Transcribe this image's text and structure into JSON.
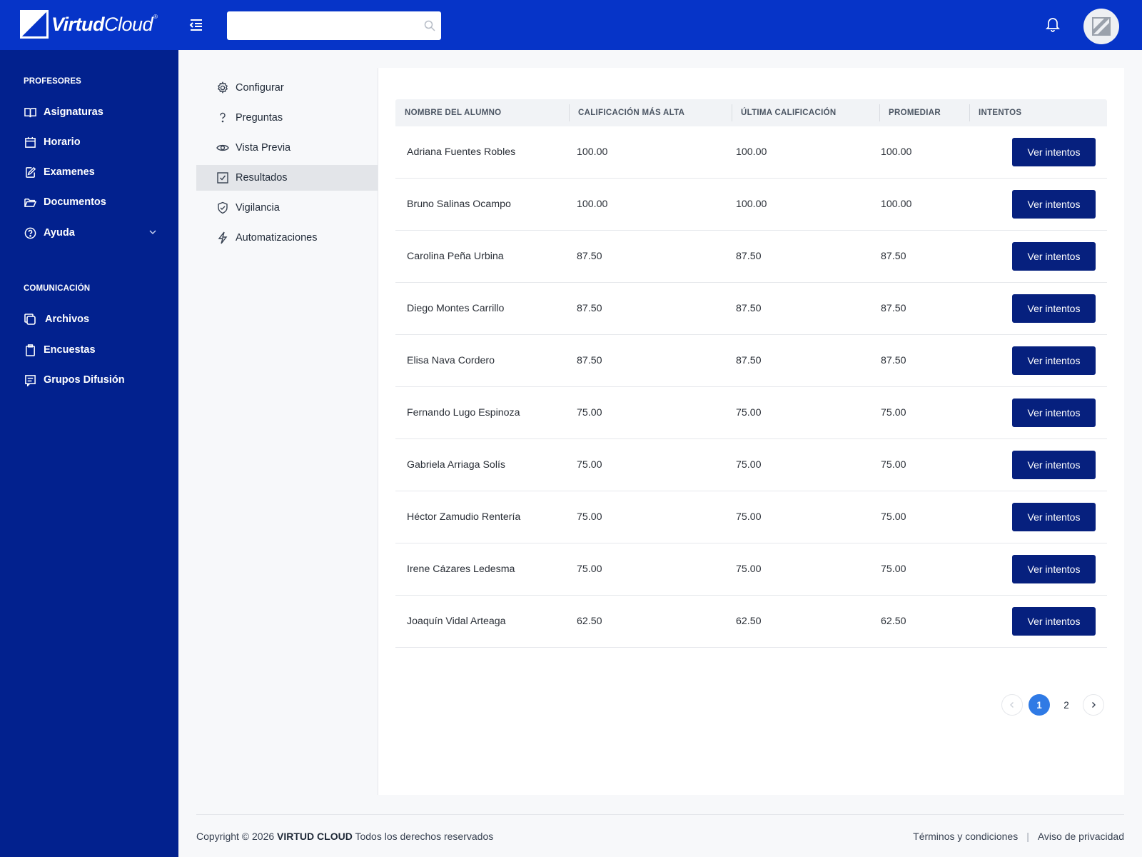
{
  "brand": {
    "name_bold": "Virtud",
    "name_light": "Cloud",
    "trademark": "®"
  },
  "header": {
    "search": {
      "value": "",
      "placeholder": ""
    },
    "icons": {
      "menu": "menu-collapse-icon",
      "search": "search-icon",
      "notifications": "bell-icon",
      "avatar": "avatar-icon"
    }
  },
  "colors": {
    "header_bg": "#0634c8",
    "sidebar_bg": "#02218e",
    "button_bg": "#06207e",
    "pager_active": "#2f7ae5"
  },
  "sidebar": {
    "sections": [
      {
        "title": "PROFESORES",
        "items": [
          {
            "label": "Asignaturas",
            "icon": "book-open-icon"
          },
          {
            "label": "Horario",
            "icon": "calendar-icon"
          },
          {
            "label": "Examenes",
            "icon": "edit-document-icon"
          },
          {
            "label": "Documentos",
            "icon": "folder-open-icon"
          },
          {
            "label": "Ayuda",
            "icon": "help-circle-icon",
            "has_submenu": true
          }
        ]
      },
      {
        "title": "COMUNICACIÓN",
        "items": [
          {
            "label": "Archivos",
            "icon": "copy-files-icon"
          },
          {
            "label": "Encuestas",
            "icon": "clipboard-icon"
          },
          {
            "label": "Grupos Difusión",
            "icon": "message-list-icon"
          }
        ]
      }
    ]
  },
  "subnav": {
    "items": [
      {
        "label": "Configurar",
        "icon": "gear-icon"
      },
      {
        "label": "Preguntas",
        "icon": "question-mark-icon"
      },
      {
        "label": "Vista Previa",
        "icon": "eye-icon"
      },
      {
        "label": "Resultados",
        "icon": "checkbox-icon",
        "active": true
      },
      {
        "label": "Vigilancia",
        "icon": "shield-check-icon"
      },
      {
        "label": "Automatizaciones",
        "icon": "lightning-icon"
      }
    ]
  },
  "table": {
    "headers": [
      "NOMBRE DEL ALUMNO",
      "CALIFICACIÓN MÁS ALTA",
      "ÚLTIMA CALIFICACIÓN",
      "PROMEDIAR",
      "INTENTOS"
    ],
    "button_label": "Ver intentos",
    "rows": [
      {
        "name": "Adriana Fuentes Robles",
        "highest": "100.00",
        "last": "100.00",
        "average": "100.00"
      },
      {
        "name": "Bruno Salinas Ocampo",
        "highest": "100.00",
        "last": "100.00",
        "average": "100.00"
      },
      {
        "name": "Carolina Peña Urbina",
        "highest": "87.50",
        "last": "87.50",
        "average": "87.50"
      },
      {
        "name": "Diego Montes Carrillo",
        "highest": "87.50",
        "last": "87.50",
        "average": "87.50"
      },
      {
        "name": "Elisa Nava Cordero",
        "highest": "87.50",
        "last": "87.50",
        "average": "87.50"
      },
      {
        "name": "Fernando Lugo Espinoza",
        "highest": "75.00",
        "last": "75.00",
        "average": "75.00"
      },
      {
        "name": "Gabriela Arriaga Solís",
        "highest": "75.00",
        "last": "75.00",
        "average": "75.00"
      },
      {
        "name": "Héctor Zamudio Rentería",
        "highest": "75.00",
        "last": "75.00",
        "average": "75.00"
      },
      {
        "name": "Irene Cázares Ledesma",
        "highest": "75.00",
        "last": "75.00",
        "average": "75.00"
      },
      {
        "name": "Joaquín Vidal Arteaga",
        "highest": "62.50",
        "last": "62.50",
        "average": "62.50"
      }
    ]
  },
  "pagination": {
    "pages": [
      "1",
      "2"
    ],
    "current": "1",
    "prev_icon": "chevron-left-icon",
    "next_icon": "chevron-right-icon"
  },
  "footer": {
    "copyright_prefix": "Copyright © 2026",
    "company": "VIRTUD CLOUD",
    "rights": "Todos los derechos reservados",
    "terms": "Términos y condiciones",
    "separator": "|",
    "privacy": "Aviso de privacidad"
  }
}
